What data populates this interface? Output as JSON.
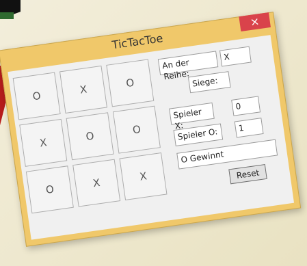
{
  "window": {
    "title": "TicTacToe",
    "close_glyph": "×"
  },
  "board": {
    "cells": [
      "O",
      "X",
      "O",
      "X",
      "O",
      "O",
      "O",
      "X",
      "X"
    ]
  },
  "info": {
    "turn_label": "An der Reihe:",
    "turn_value": "X",
    "wins_label": "Siege:",
    "player_x_label": "Spieler X:",
    "player_x_wins": "0",
    "player_o_label": "Spieler O:",
    "player_o_wins": "1",
    "status": "O Gewinnt",
    "reset_label": "Reset"
  },
  "colors": {
    "titlebar": "#f0c86a",
    "close_button": "#d9434b",
    "desktop_accent": "#b71c1c"
  }
}
